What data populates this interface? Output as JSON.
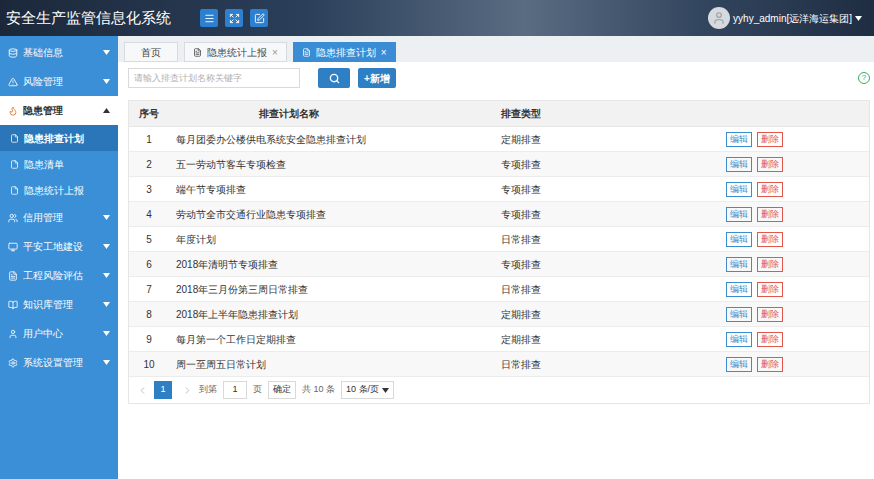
{
  "header": {
    "title": "安全生产监管信息化系统",
    "user": "yyhy_admin[远洋海运集团]"
  },
  "sidebar": {
    "items": [
      {
        "label": "基础信息",
        "expanded": false,
        "selected": false,
        "children": []
      },
      {
        "label": "风险管理",
        "expanded": false,
        "selected": false,
        "children": []
      },
      {
        "label": "隐患管理",
        "expanded": true,
        "selected": true,
        "children": [
          {
            "label": "隐患排查计划",
            "selected": true
          },
          {
            "label": "隐患清单",
            "selected": false
          },
          {
            "label": "隐患统计上报",
            "selected": false
          }
        ]
      },
      {
        "label": "信用管理",
        "expanded": false,
        "selected": false,
        "children": []
      },
      {
        "label": "平安工地建设",
        "expanded": false,
        "selected": false,
        "children": []
      },
      {
        "label": "工程风险评估",
        "expanded": false,
        "selected": false,
        "children": []
      },
      {
        "label": "知识库管理",
        "expanded": false,
        "selected": false,
        "children": []
      },
      {
        "label": "用户中心",
        "expanded": false,
        "selected": false,
        "children": []
      },
      {
        "label": "系统设置管理",
        "expanded": false,
        "selected": false,
        "children": []
      }
    ]
  },
  "tab_bar": {
    "close_mark": "×",
    "tabs": [
      {
        "label": "首页",
        "selected": false,
        "closable": false
      },
      {
        "label": "隐患统计上报",
        "selected": false,
        "closable": true
      },
      {
        "label": "隐患排查计划",
        "selected": true,
        "closable": true
      }
    ]
  },
  "toolbar": {
    "search": {
      "placeholder": "请输入排查计划名称关键字"
    },
    "add_button": "+新增",
    "help": "?"
  },
  "table": {
    "columns": [
      "序号",
      "排查计划名称",
      "排查类型"
    ],
    "rows": [
      {
        "index": "1",
        "name": "每月团委办公楼供电系统安全隐患排查计划",
        "type": "定期排查",
        "actions": [
          "编辑",
          "删除"
        ]
      },
      {
        "index": "2",
        "name": "五一劳动节客车专项检查",
        "type": "专项排查",
        "actions": [
          "编辑",
          "删除"
        ]
      },
      {
        "index": "3",
        "name": "端午节专项排查",
        "type": "专项排查",
        "actions": [
          "编辑",
          "删除"
        ]
      },
      {
        "index": "4",
        "name": "劳动节全市交通行业隐患专项排查",
        "type": "专项排查",
        "actions": [
          "编辑",
          "删除"
        ]
      },
      {
        "index": "5",
        "name": "年度计划",
        "type": "日常排查",
        "actions": [
          "编辑",
          "删除"
        ]
      },
      {
        "index": "6",
        "name": "2018年清明节专项排查",
        "type": "专项排查",
        "actions": [
          "编辑",
          "删除"
        ]
      },
      {
        "index": "7",
        "name": "2018年三月份第三周日常排查",
        "type": "日常排查",
        "actions": [
          "编辑",
          "删除"
        ]
      },
      {
        "index": "8",
        "name": "2018年上半年隐患排查计划",
        "type": "定期排查",
        "actions": [
          "编辑",
          "删除"
        ]
      },
      {
        "index": "9",
        "name": "每月第一个工作日定期排查",
        "type": "定期排查",
        "actions": [
          "编辑",
          "删除"
        ]
      },
      {
        "index": "10",
        "name": "周一至周五日常计划",
        "type": "日常排查",
        "actions": [
          "编辑",
          "删除"
        ]
      }
    ]
  },
  "pagination": {
    "current": "1",
    "goto_label": "到第",
    "goto_value": "1",
    "page_unit": "页",
    "confirm": "确定",
    "total": "共 10 条",
    "page_size": "10 条/页"
  }
}
